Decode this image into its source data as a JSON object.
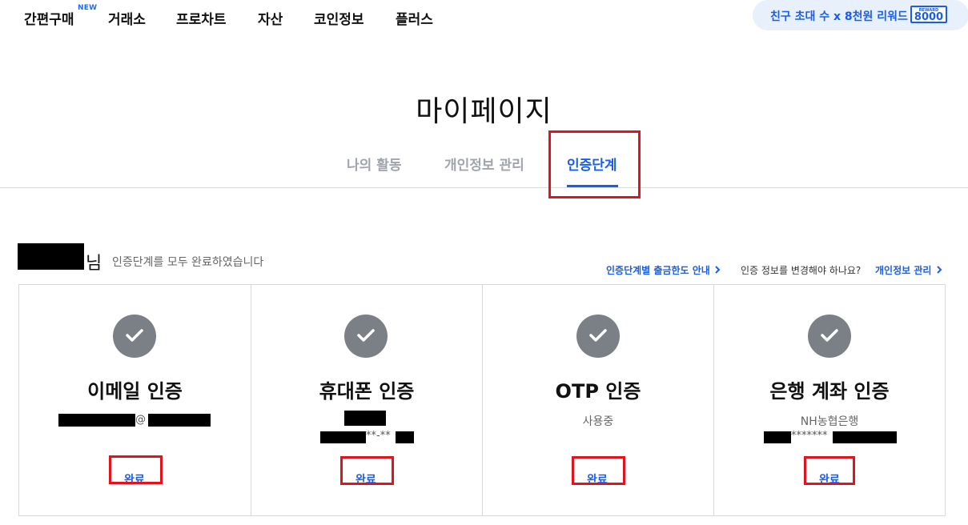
{
  "nav": {
    "items": [
      "간편구매",
      "거래소",
      "프로차트",
      "자산",
      "코인정보",
      "플러스"
    ],
    "new_badge": "NEW",
    "promo_text": "친구 초대 수 x 8천원 리워드",
    "promo_badge_label": "REWARD",
    "promo_badge_value": "8000"
  },
  "page": {
    "title": "마이페이지",
    "tabs": [
      "나의 활동",
      "개인정보 관리",
      "인증단계"
    ],
    "active_tab": "인증단계"
  },
  "summary": {
    "suffix": "님",
    "message": "인증단계를 모두 완료하였습니다",
    "guide_link": "인증단계별 출금한도 안내",
    "change_question": "인증 정보를 변경해야 하나요?",
    "info_link": "개인정보 관리"
  },
  "cards": [
    {
      "title": "이메일 인증",
      "line1": "@",
      "line2": "",
      "status": "완료"
    },
    {
      "title": "휴대폰 인증",
      "line1": "",
      "line2": "**-**",
      "status": "완료"
    },
    {
      "title": "OTP 인증",
      "line1": "사용중",
      "line2": "",
      "status": "완료"
    },
    {
      "title": "은행 계좌 인증",
      "line1": "NH농협은행",
      "line2": "*******",
      "status": "완료"
    }
  ],
  "colors": {
    "accent": "#1a5ee8",
    "highlight": "#e1141e",
    "check_bg": "#7b7f86"
  },
  "icons": [
    "check-icon",
    "chevron-right-icon"
  ]
}
